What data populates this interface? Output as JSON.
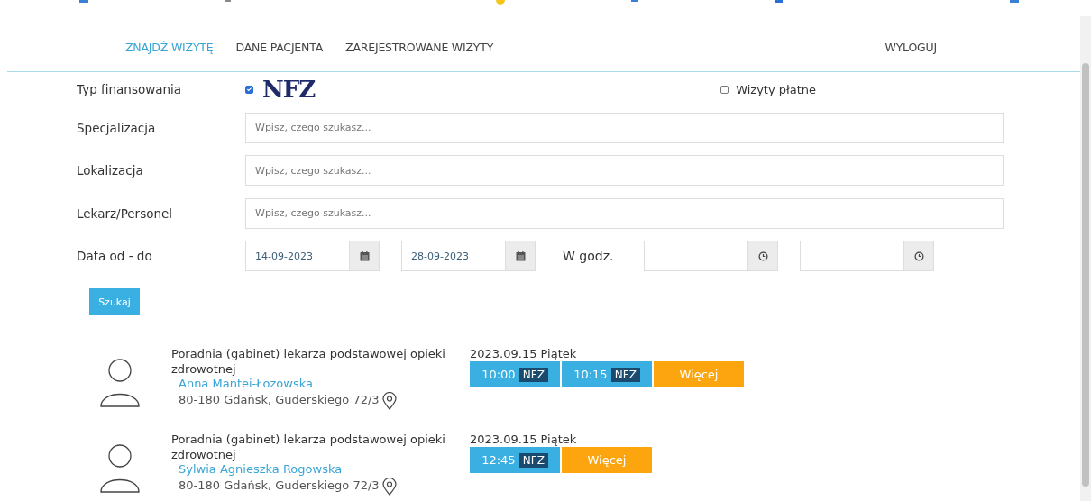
{
  "nav": {
    "items": [
      {
        "label": "ZNAJDŹ WIZYTĘ",
        "selected": true
      },
      {
        "label": "DANE PACJENTA",
        "selected": false
      },
      {
        "label": "ZAREJESTROWANE WIZYTY",
        "selected": false
      }
    ],
    "logout": "WYLOGUJ"
  },
  "financing": {
    "label": "Typ finansowania",
    "nfz_checked": true,
    "nfz_logo": "NFZ",
    "paid_checked": false,
    "paid_label": "Wizyty płatne"
  },
  "fields": [
    {
      "label": "Specjalizacja",
      "placeholder": "Wpisz, czego szukasz..."
    },
    {
      "label": "Lokalizacja",
      "placeholder": "Wpisz, czego szukasz..."
    },
    {
      "label": "Lekarz/Personel",
      "placeholder": "Wpisz, czego szukasz..."
    }
  ],
  "dates": {
    "label": "Data od - do",
    "from": "14-09-2023",
    "to": "28-09-2023",
    "hours_label": "W godz."
  },
  "search_button": "Szukaj",
  "results": [
    {
      "clinic": "Poradnia (gabinet) lekarza podstawowej opieki zdrowotnej",
      "doctor": "Anna Mantei-Łozowska",
      "address": "80-180 Gdańsk, Guderskiego 72/3",
      "date": "2023.09.15 Piątek",
      "slots": [
        {
          "time": "10:00",
          "tag": "NFZ"
        },
        {
          "time": "10:15",
          "tag": "NFZ"
        }
      ],
      "more": "Więcej"
    },
    {
      "clinic": "Poradnia (gabinet) lekarza podstawowej opieki zdrowotnej",
      "doctor": "Sylwia Agnieszka Rogowska",
      "address": "80-180 Gdańsk, Guderskiego 72/3",
      "date": "2023.09.15 Piątek",
      "slots": [
        {
          "time": "12:45",
          "tag": "NFZ"
        }
      ],
      "more": "Więcej"
    }
  ]
}
